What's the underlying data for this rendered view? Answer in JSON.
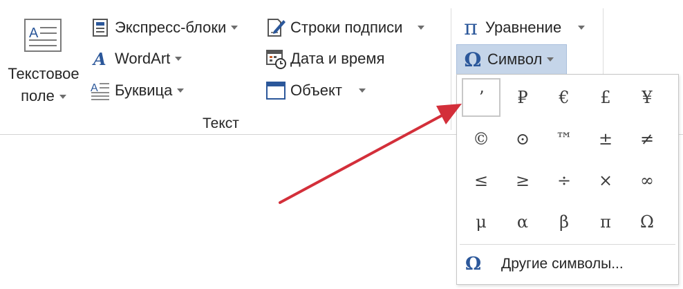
{
  "ribbon": {
    "textbox": {
      "line1": "Текстовое",
      "line2": "поле"
    },
    "quick_parts": "Экспресс-блоки",
    "wordart": "WordArt",
    "dropcap": "Буквица",
    "signature": "Строки подписи",
    "datetime": "Дата и время",
    "object": "Объект",
    "equation": "Уравнение",
    "symbol": "Символ",
    "group_text": "Текст"
  },
  "symbols": {
    "grid": [
      [
        "ʼ",
        "₽",
        "€",
        "£",
        "¥"
      ],
      [
        "©",
        "⊙",
        "™",
        "±",
        "≠"
      ],
      [
        "≤",
        "≥",
        "÷",
        "×",
        "∞"
      ],
      [
        "μ",
        "α",
        "β",
        "π",
        "Ω"
      ]
    ],
    "more_label": "Другие символы...",
    "omega_glyph": "Ω",
    "pi_glyph": "π"
  },
  "colors": {
    "accent_blue": "#2b579a",
    "symbol_button_bg": "#c5d5e9",
    "annotation_arrow": "#d32f3a"
  }
}
